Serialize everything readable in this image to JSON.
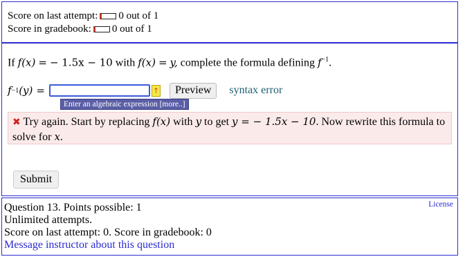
{
  "score": {
    "last_attempt_label": "Score on last attempt:",
    "last_attempt_value": "0 out of 1",
    "gradebook_label": "Score in gradebook:",
    "gradebook_value": "0 out of 1"
  },
  "question": {
    "prompt_if": "If",
    "prompt_fx": "f(x)",
    "prompt_eq": "=",
    "prompt_expr": "− 1.5x − 10",
    "prompt_with": "with",
    "prompt_fx2": "f(x)",
    "prompt_eq2": "=",
    "prompt_y": "y,",
    "prompt_rest": "complete the formula defining",
    "prompt_f": "f",
    "prompt_sup": "−1",
    "prompt_end": ".",
    "answer_f": "f",
    "answer_sup": "−1",
    "answer_arg": "(y)",
    "answer_eq": "=",
    "answer_value": "",
    "symbol_icon": "↑",
    "preview_label": "Preview",
    "syntax_error": "syntax error",
    "hint_tip": "Enter an algebraic expression [more..]",
    "submit_label": "Submit"
  },
  "feedback": {
    "icon": "✖",
    "text_1": "Try again. Start by replacing",
    "text_fx": "f(x)",
    "text_2": "with",
    "text_y": "y",
    "text_3": "to get",
    "text_expr": "y = − 1.5x − 10",
    "text_4": ". Now rewrite this formula to solve for",
    "text_x": "x",
    "text_5": "."
  },
  "info": {
    "question_line": "Question 13. Points possible: 1",
    "attempts_line": "Unlimited attempts.",
    "score_line": "Score on last attempt: 0. Score in gradebook: 0",
    "message_link": "Message instructor about this question",
    "license_link": "License"
  },
  "colors": {
    "border": "#2a2ad0",
    "feedback_bg": "#fbeaea",
    "tip_bg": "#5b5ea6",
    "error_text": "#1c5f73",
    "x_icon": "#d42020"
  }
}
